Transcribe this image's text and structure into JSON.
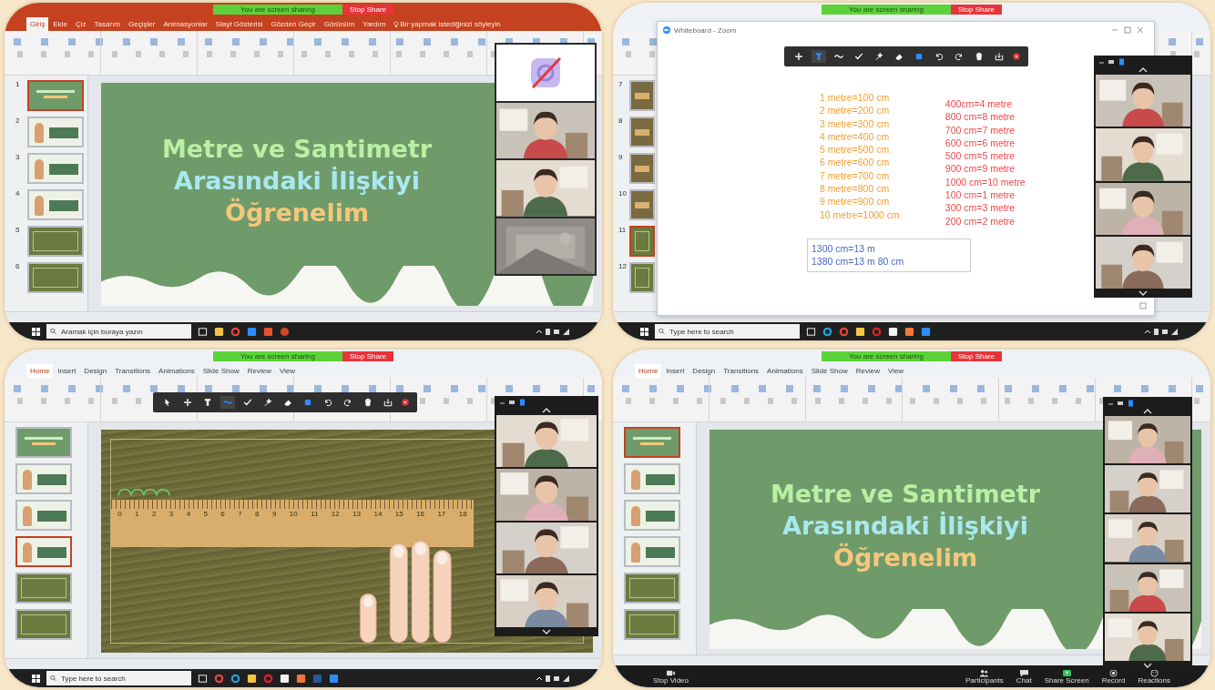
{
  "panels": [
    {
      "kind": "office2016",
      "share": {
        "status": "You are screen sharing",
        "stop": "Stop Share"
      },
      "tabs": [
        {
          "label": "Giriş",
          "selected": true
        },
        {
          "label": "Ekle",
          "selected": false
        },
        {
          "label": "Çiz",
          "selected": false
        },
        {
          "label": "Tasarım",
          "selected": false
        },
        {
          "label": "Geçişler",
          "selected": false
        },
        {
          "label": "Animasyonlar",
          "selected": false
        },
        {
          "label": "Slayt Gösterisi",
          "selected": false
        },
        {
          "label": "Gözden Geçir",
          "selected": false
        },
        {
          "label": "Görünüm",
          "selected": false
        },
        {
          "label": "Yardım",
          "selected": false
        }
      ],
      "tell_me": "Bir yapmak istediğinizi söyleyin",
      "thumbnails": [
        {
          "number": "1",
          "kind": "title",
          "selected": true
        },
        {
          "number": "2",
          "kind": "character",
          "selected": false
        },
        {
          "number": "3",
          "kind": "character",
          "selected": false
        },
        {
          "number": "4",
          "kind": "character",
          "selected": false
        },
        {
          "number": "5",
          "kind": "board",
          "selected": false
        },
        {
          "number": "6",
          "kind": "board",
          "selected": false
        }
      ],
      "slide": {
        "kind": "title",
        "lines": [
          {
            "text": "Metre ve Santimetr",
            "color": "#b9f0a4"
          },
          {
            "text": "Arasındaki İlişkiyi",
            "color": "#a9e8ee"
          },
          {
            "text": "Öğrenelim",
            "color": "#f6c77a"
          }
        ]
      },
      "gallery": {
        "header": false,
        "tiles": [
          {
            "kind": "video_off"
          },
          {
            "kind": "person"
          },
          {
            "kind": "person"
          },
          {
            "kind": "blank"
          }
        ]
      },
      "bottom": {
        "kind": "taskbar",
        "placeholder": "Aramak için buraya yazın",
        "apps": [
          {
            "kind": "taskview"
          },
          {
            "kind": "folder"
          },
          {
            "kind": "chrome"
          },
          {
            "kind": "zoom"
          },
          {
            "kind": "office"
          },
          {
            "kind": "powerpoint"
          }
        ]
      }
    },
    {
      "kind": "office2010",
      "share": {
        "status": "You are screen sharing",
        "stop": "Stop Share"
      },
      "thumbnails": [
        {
          "number": "7",
          "kind": "ruler",
          "selected": false
        },
        {
          "number": "8",
          "kind": "ruler",
          "selected": false
        },
        {
          "number": "9",
          "kind": "ruler",
          "selected": false
        },
        {
          "number": "10",
          "kind": "ruler",
          "selected": false
        },
        {
          "number": "11",
          "kind": "board",
          "selected": true
        },
        {
          "number": "12",
          "kind": "board",
          "selected": false
        }
      ],
      "whiteboard": {
        "title": "Whiteboard - Zoom",
        "tools": [
          {
            "kind": "select",
            "selected": false
          },
          {
            "kind": "text",
            "selected": true
          },
          {
            "kind": "draw",
            "selected": false
          },
          {
            "kind": "stamp",
            "selected": false
          },
          {
            "kind": "spotlight",
            "selected": false
          },
          {
            "kind": "eraser",
            "selected": false
          },
          {
            "kind": "format",
            "selected": false
          },
          {
            "kind": "undo",
            "selected": false
          },
          {
            "kind": "redo",
            "selected": false
          },
          {
            "kind": "clear",
            "selected": false
          },
          {
            "kind": "save",
            "selected": false
          }
        ],
        "columns": [
          {
            "color": "#f0a030",
            "lines": [
              "1 metre=100 cm",
              "2 metre=200 cm",
              "3 metre=300 cm",
              "4 metre=400 cm",
              "5 metre=500 cm",
              "6 metre=600 cm",
              "7 metre=700 cm",
              "8 metre=800 cm",
              "9 metre=900 cm",
              "10 metre=1000 cm"
            ]
          },
          {
            "color": "#f0484a",
            "lines": [
              "400cm=4 metre",
              "800 cm=8 metre",
              "700 cm=7 metre",
              "600 cm=6 metre",
              "500 cm=5 metre",
              "900 cm=9 metre",
              "1000 cm=10 metre",
              "100 cm=1 metre",
              "300 cm=3 metre",
              "200 cm=2 metre"
            ]
          }
        ],
        "box": {
          "color": "#4a68c0",
          "lines": [
            "1300 cm=13 m",
            "1380 cm=13 m 80 cm"
          ]
        }
      },
      "gallery": {
        "header": true,
        "tiles": [
          {
            "kind": "person"
          },
          {
            "kind": "person"
          },
          {
            "kind": "person"
          },
          {
            "kind": "person"
          }
        ]
      },
      "bottom": {
        "kind": "taskbar",
        "placeholder": "Type here to search",
        "apps": [
          {
            "kind": "taskview"
          },
          {
            "kind": "edge"
          },
          {
            "kind": "chrome"
          },
          {
            "kind": "folder"
          },
          {
            "kind": "opera"
          },
          {
            "kind": "file"
          },
          {
            "kind": "photos"
          },
          {
            "kind": "zoom"
          }
        ]
      }
    },
    {
      "kind": "office2010",
      "share": {
        "status": "You are screen sharing",
        "stop": "Stop Share"
      },
      "tabs": [
        {
          "label": "Home",
          "selected": true
        },
        {
          "label": "Insert",
          "selected": false
        },
        {
          "label": "Design",
          "selected": false
        },
        {
          "label": "Transitions",
          "selected": false
        },
        {
          "label": "Animations",
          "selected": false
        },
        {
          "label": "Slide Show",
          "selected": false
        },
        {
          "label": "Review",
          "selected": false
        },
        {
          "label": "View",
          "selected": false
        }
      ],
      "toolbar": [
        {
          "kind": "mouse",
          "selected": false
        },
        {
          "kind": "select",
          "selected": false
        },
        {
          "kind": "text",
          "selected": false
        },
        {
          "kind": "draw",
          "selected": true
        },
        {
          "kind": "stamp",
          "selected": false
        },
        {
          "kind": "spotlight",
          "selected": false
        },
        {
          "kind": "eraser",
          "selected": false
        },
        {
          "kind": "format",
          "selected": false
        },
        {
          "kind": "undo",
          "selected": false
        },
        {
          "kind": "redo",
          "selected": false
        },
        {
          "kind": "clear",
          "selected": false
        },
        {
          "kind": "save",
          "selected": false
        }
      ],
      "thumbnails": [
        {
          "kind": "title",
          "selected": false
        },
        {
          "kind": "character",
          "selected": false
        },
        {
          "kind": "character",
          "selected": false
        },
        {
          "kind": "character",
          "selected": true
        },
        {
          "kind": "board",
          "selected": false
        },
        {
          "kind": "board",
          "selected": false
        }
      ],
      "slide": {
        "kind": "ruler",
        "ticks": [
          "0",
          "1",
          "2",
          "3",
          "4",
          "5",
          "6",
          "7",
          "8",
          "9",
          "10",
          "11",
          "12",
          "13",
          "14",
          "15",
          "16",
          "17",
          "18"
        ]
      },
      "gallery": {
        "header": true,
        "tiles": [
          {
            "kind": "person"
          },
          {
            "kind": "person"
          },
          {
            "kind": "person"
          },
          {
            "kind": "person"
          }
        ]
      },
      "bottom": {
        "kind": "taskbar",
        "placeholder": "Type here to search",
        "apps": [
          {
            "kind": "taskview"
          },
          {
            "kind": "chrome"
          },
          {
            "kind": "edge"
          },
          {
            "kind": "folder"
          },
          {
            "kind": "opera"
          },
          {
            "kind": "file"
          },
          {
            "kind": "photos"
          },
          {
            "kind": "word"
          },
          {
            "kind": "zoom"
          }
        ]
      }
    },
    {
      "kind": "office2010",
      "share": {
        "status": "You are screen sharing",
        "stop": "Stop Share"
      },
      "tabs": [
        {
          "label": "Home",
          "selected": true
        },
        {
          "label": "Insert",
          "selected": false
        },
        {
          "label": "Design",
          "selected": false
        },
        {
          "label": "Transitions",
          "selected": false
        },
        {
          "label": "Animations",
          "selected": false
        },
        {
          "label": "Slide Show",
          "selected": false
        },
        {
          "label": "Review",
          "selected": false
        },
        {
          "label": "View",
          "selected": false
        }
      ],
      "thumbnails": [
        {
          "kind": "title",
          "selected": true
        },
        {
          "kind": "character",
          "selected": false
        },
        {
          "kind": "character",
          "selected": false
        },
        {
          "kind": "character",
          "selected": false
        },
        {
          "kind": "board",
          "selected": false
        },
        {
          "kind": "board",
          "selected": false
        }
      ],
      "slide": {
        "kind": "title",
        "lines": [
          {
            "text": "Metre ve Santimetr",
            "color": "#b9f0a4"
          },
          {
            "text": "Arasındaki İlişkiyi",
            "color": "#a9e8ee"
          },
          {
            "text": "Öğrenelim",
            "color": "#f6c77a"
          }
        ]
      },
      "gallery": {
        "header": true,
        "tiles": [
          {
            "kind": "person"
          },
          {
            "kind": "person"
          },
          {
            "kind": "person"
          },
          {
            "kind": "person"
          },
          {
            "kind": "person"
          }
        ]
      },
      "bottom": {
        "kind": "zoom_controls",
        "buttons": [
          {
            "kind": "video",
            "label": "Stop Video"
          },
          {
            "kind": "participants",
            "label": "Participants"
          },
          {
            "kind": "chat",
            "label": "Chat"
          },
          {
            "kind": "share",
            "label": "Share Screen"
          },
          {
            "kind": "record",
            "label": "Record"
          },
          {
            "kind": "reactions",
            "label": "Reactions"
          }
        ]
      }
    }
  ]
}
